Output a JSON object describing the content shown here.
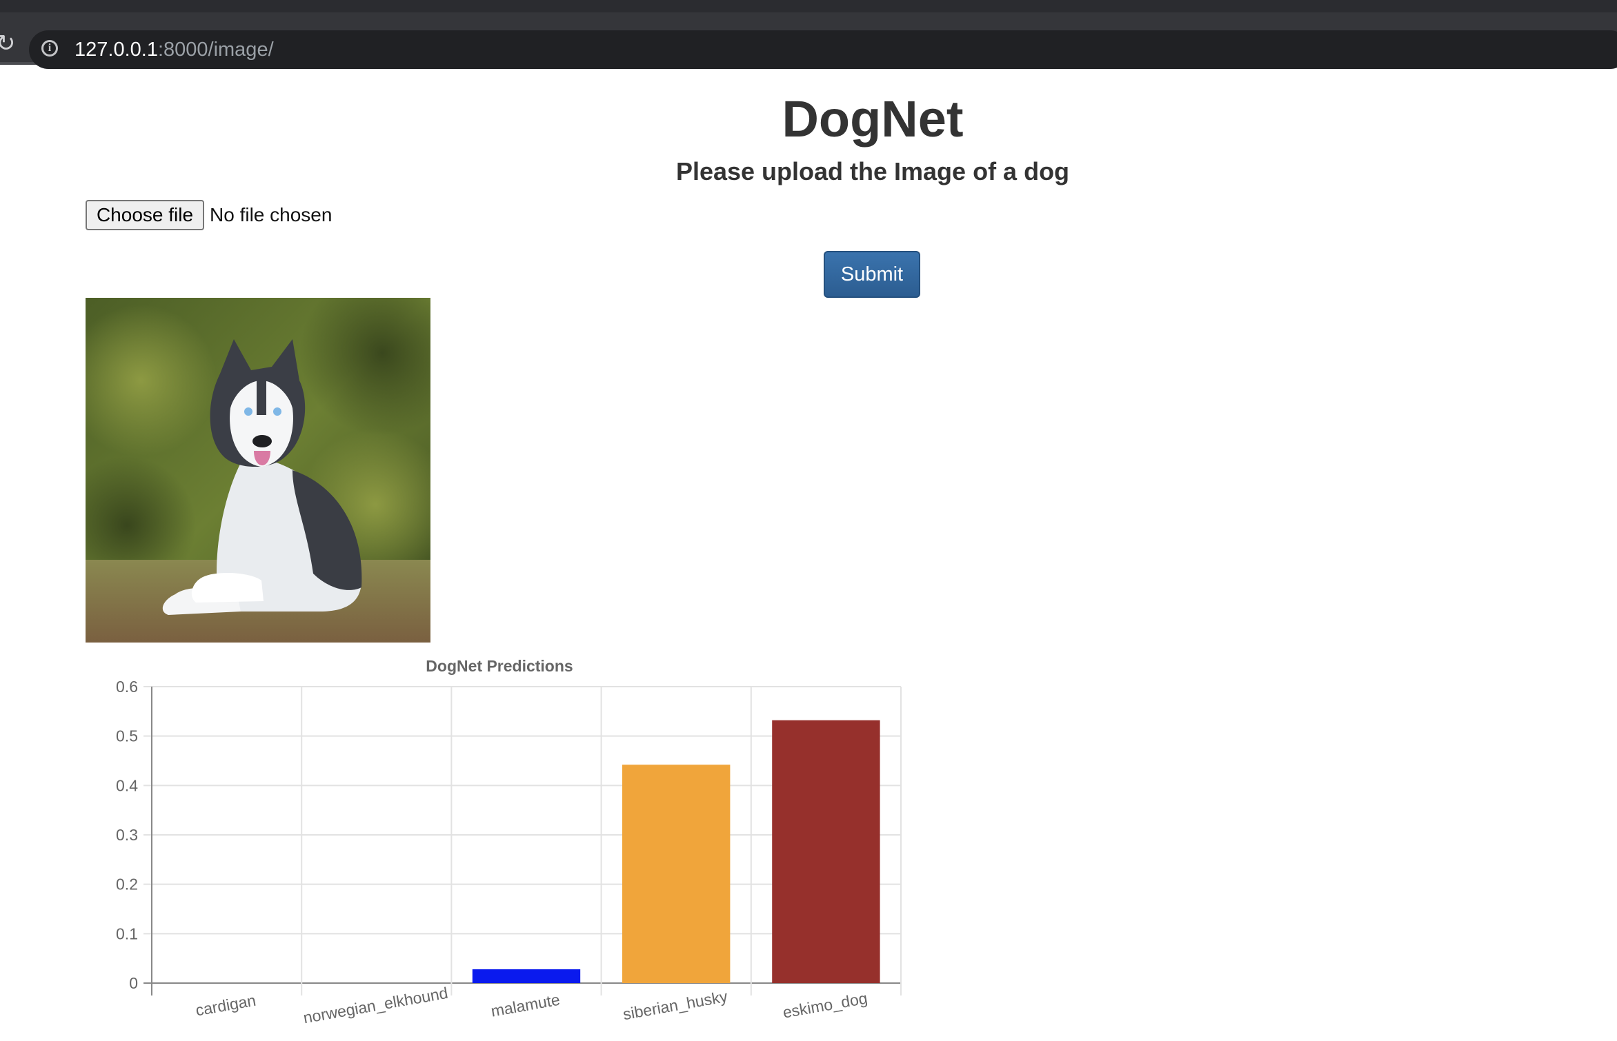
{
  "browser": {
    "url_host": "127.0.0.1",
    "url_path": ":8000/image/",
    "info_icon": "info-icon",
    "reload_icon": "reload-icon"
  },
  "page": {
    "title": "DogNet",
    "subtitle": "Please upload the Image of a dog",
    "file_input": {
      "button_label": "Choose file",
      "status": "No file chosen"
    },
    "submit_label": "Submit",
    "image_subject": "siberian husky lying on grass"
  },
  "colors": {
    "submit_bg": "#337ab7",
    "text": "#333333"
  },
  "chart_data": {
    "type": "bar",
    "title": "DogNet Predictions",
    "categories": [
      "cardigan",
      "norwegian_elkhound",
      "malamute",
      "siberian_husky",
      "eskimo_dog"
    ],
    "values": [
      0.0,
      0.0,
      0.028,
      0.442,
      0.532
    ],
    "colors": [
      "#1a1aff",
      "#1a1aff",
      "#0a1aee",
      "#f0a53b",
      "#96302c"
    ],
    "ylim": [
      0,
      0.6
    ],
    "yticks": [
      0,
      0.1,
      0.2,
      0.3,
      0.4,
      0.5,
      0.6
    ],
    "ytick_labels": [
      "0",
      "0.1",
      "0.2",
      "0.3",
      "0.4",
      "0.5",
      "0.6"
    ],
    "grid": true,
    "legend": "none"
  }
}
